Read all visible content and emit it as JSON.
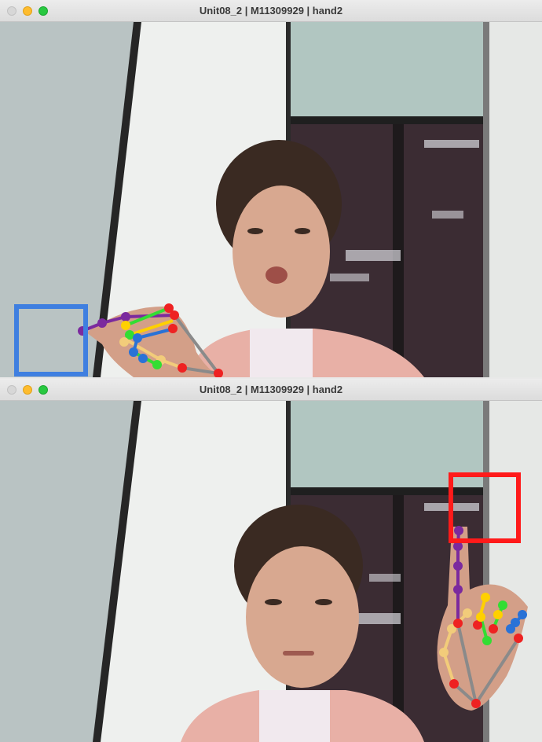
{
  "windows": [
    {
      "title": "Unit08_2 | M11309929 | hand2",
      "traffic_lights": {
        "close": "#d7d7d7",
        "minimize": "#febc2e",
        "maximize": "#28c840"
      },
      "target_box_color": "#3f7fe0",
      "target_box_label": "blue-square"
    },
    {
      "title": "Unit08_2 | M11309929 | hand2",
      "traffic_lights": {
        "close": "#d7d7d7",
        "minimize": "#febc2e",
        "maximize": "#28c840"
      },
      "target_box_color": "#ff1a1a",
      "target_box_label": "red-square"
    }
  ],
  "landmark_colors": {
    "thumb": "#f2cc7a",
    "index": "#7b2a9e",
    "middle": "#ffd000",
    "ring": "#33dd33",
    "pinky": "#2a72d6",
    "joint": "#ee2222",
    "palm": "#8a8a8a"
  }
}
